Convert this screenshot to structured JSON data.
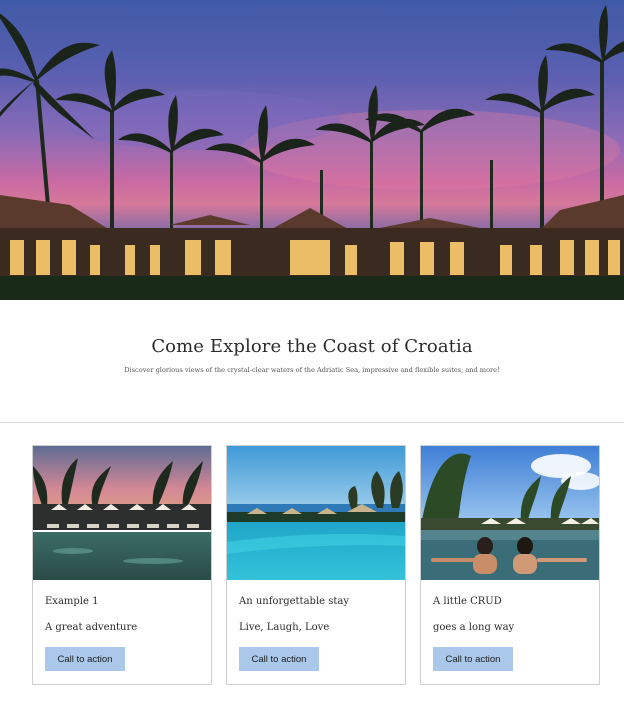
{
  "hero": {
    "image": "tropical-resort-palm-trees-dusk"
  },
  "intro": {
    "title": "Come Explore the Coast of Croatia",
    "subtitle": "Discover glorious views of the crystal-clear waters of the Adriatic Sea, impressive and flexible suites, and more!"
  },
  "cards": [
    {
      "image": "resort-pool-with-umbrellas-at-dusk",
      "title": "Example 1",
      "text": "A great adventure",
      "cta": "Call to action"
    },
    {
      "image": "infinity-pool-by-the-sea",
      "title": "An unforgettable stay",
      "text": "Live, Laugh, Love",
      "cta": "Call to action"
    },
    {
      "image": "couple-in-infinity-pool",
      "title": "A little CRUD",
      "text": "goes a long way",
      "cta": "Call to action"
    }
  ],
  "colors": {
    "cta_background": "#a9c8ea",
    "divider": "#d9d9d9",
    "card_border": "#cfcfcf"
  }
}
